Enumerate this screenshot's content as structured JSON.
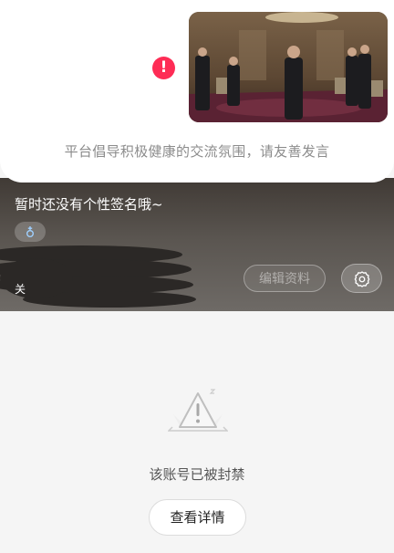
{
  "chat": {
    "failed_icon": "exclamation-circle-icon",
    "failed_color": "#fe2c55",
    "notice": "平台倡导积极健康的交流氛围，请友善发言"
  },
  "profile": {
    "signature": "暂时还没有个性签名哦~",
    "gender_icon": "gender-icon",
    "follow_label": "关",
    "edit_button": "编辑资料",
    "settings_icon": "gear-icon"
  },
  "banned": {
    "icon": "warning-triangle-icon",
    "message": "该账号已被封禁",
    "details_button": "查看详情"
  }
}
